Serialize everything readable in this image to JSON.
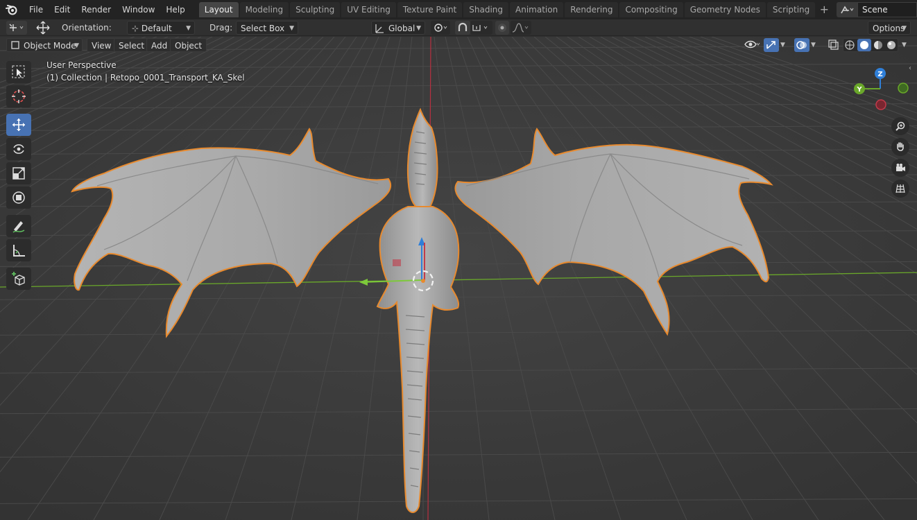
{
  "app": "Blender",
  "menu": [
    "File",
    "Edit",
    "Render",
    "Window",
    "Help"
  ],
  "workspaces": [
    {
      "label": "Layout",
      "active": true
    },
    {
      "label": "Modeling",
      "active": false
    },
    {
      "label": "Sculpting",
      "active": false
    },
    {
      "label": "UV Editing",
      "active": false
    },
    {
      "label": "Texture Paint",
      "active": false
    },
    {
      "label": "Shading",
      "active": false
    },
    {
      "label": "Animation",
      "active": false
    },
    {
      "label": "Rendering",
      "active": false
    },
    {
      "label": "Compositing",
      "active": false
    },
    {
      "label": "Geometry Nodes",
      "active": false
    },
    {
      "label": "Scripting",
      "active": false
    }
  ],
  "scene": {
    "name": "Scene"
  },
  "tool_header": {
    "orientation_label": "Orientation:",
    "orientation_value": "Default",
    "drag_label": "Drag:",
    "drag_value": "Select Box",
    "transform_orientation": "Global",
    "options_label": "Options"
  },
  "viewport_header": {
    "mode": "Object Mode",
    "menus": [
      "View",
      "Select",
      "Add",
      "Object"
    ]
  },
  "viewport": {
    "perspective": "User Perspective",
    "collection": "(1) Collection | Retopo_0001_Transport_KA_Skel"
  },
  "gizmo": {
    "z_label": "Z",
    "y_label": "Y"
  },
  "colors": {
    "accent": "#4772b3",
    "selection_outline": "#e88a2e",
    "x_axis": "#c23a4a",
    "y_axis": "#5fa020",
    "z_axis": "#2f7fd8"
  },
  "icons": {
    "toolbar": [
      "select-box-icon",
      "cursor-icon",
      "move-icon",
      "rotate-icon",
      "scale-icon",
      "transform-icon",
      "annotate-icon",
      "measure-icon",
      "add-cube-icon"
    ],
    "navigation": [
      "zoom-icon",
      "pan-hand-icon",
      "camera-icon",
      "grid-view-icon"
    ]
  }
}
